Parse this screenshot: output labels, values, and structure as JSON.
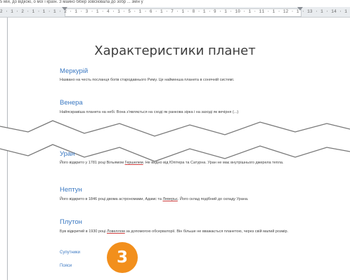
{
  "window": {
    "top_fragment": "5 мій, до відкою, о мої і країн. З майно бібер зовсіювала до зобр ... змін у"
  },
  "ruler": {
    "scale": "2 · 1 · 2 · 1 · 1 · 1 · 2 · 1 · 3 · 1 · 4 · 1 · 5 · 1 · 6 · 1 · 7 · 1 · 8 · 1 · 9 · 1 · 10 · 1 · 11 · 1 · 12 · 1 · 13 · 1 · 14 · 1 · 15 · 1 · 16 · 1 · 17 · 18"
  },
  "document": {
    "title": "Характеристики планет",
    "sections": [
      {
        "heading": "Меркурій",
        "body": "Названо на честь посланця богів стародавнього Риму. Це найменша планета в сонячній системі."
      },
      {
        "heading": "Венера",
        "body": "Найяскравіша планета на небі. Вона з'являється на сході як ранкова зірка і на заході як вечірня (...)"
      },
      {
        "heading": "Уран",
        "body_pre": "Його відкрито у 1781 році Вільямом ",
        "body_err": "Гершелем",
        "body_post": ". Не видно від Юпітера та Сатурна. Уран не має внутрішнього джерела тепла."
      },
      {
        "heading": "Нептун",
        "body_pre": "Його відкрито в 1846 році двома астрономами, Адамс та ",
        "body_err": "Леверьє",
        "body_post": ". Його склад подібний до складу Урана."
      },
      {
        "heading": "Плутон",
        "body_pre": "Був відкритий в 1930 році ",
        "body_err": "Ловеллом",
        "body_post": " за допомогою обсерваторії. Він більше не вважається планетою, через свій малий розмір."
      }
    ],
    "links": [
      "Супутники",
      "Пояси"
    ]
  },
  "badge": {
    "number": "3"
  },
  "colors": {
    "heading": "#3a78c2",
    "badge": "#f28f1c",
    "ruler": "#e9ecef"
  }
}
